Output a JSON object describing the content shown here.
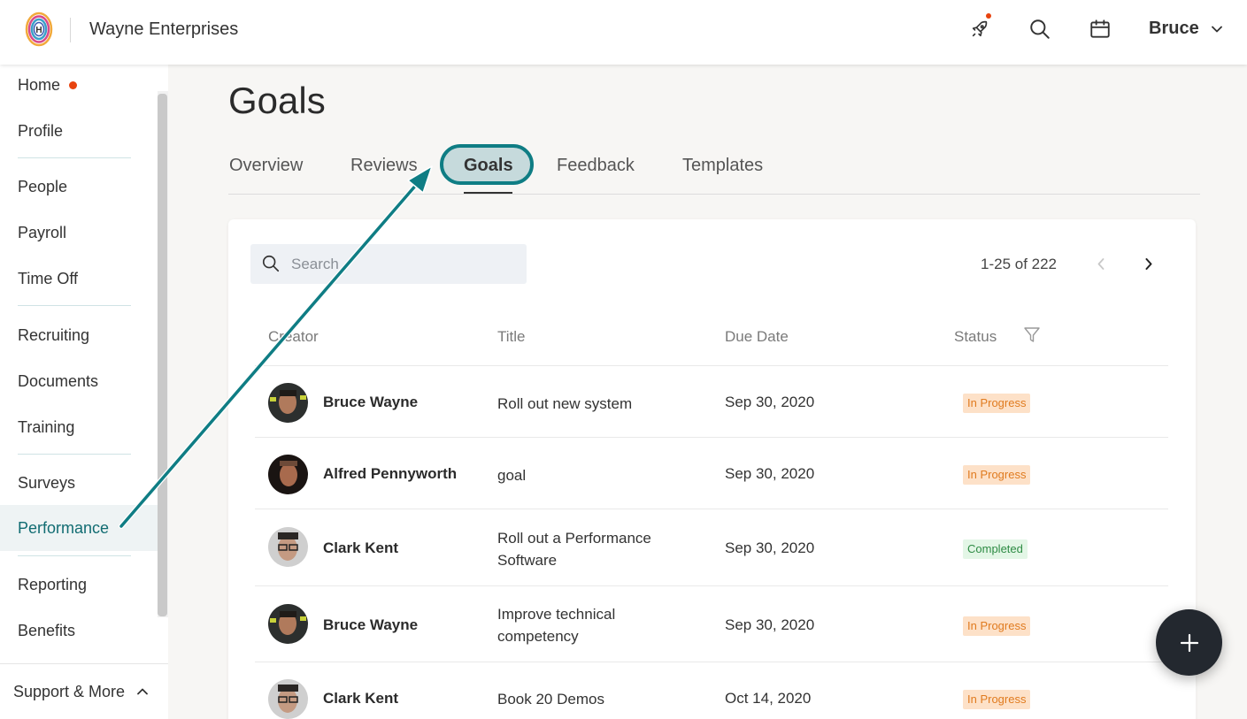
{
  "header": {
    "company": "Wayne Enterprises",
    "logo_letter": "H",
    "user_name": "Bruce"
  },
  "sidebar": {
    "items": [
      {
        "label": "Home"
      },
      {
        "label": "Profile"
      },
      {
        "label": "People"
      },
      {
        "label": "Payroll"
      },
      {
        "label": "Time Off"
      },
      {
        "label": "Recruiting"
      },
      {
        "label": "Documents"
      },
      {
        "label": "Training"
      },
      {
        "label": "Surveys"
      },
      {
        "label": "Performance"
      },
      {
        "label": "Reporting"
      },
      {
        "label": "Benefits"
      }
    ],
    "support_label": "Support & More"
  },
  "page": {
    "title": "Goals",
    "tabs": [
      {
        "label": "Overview"
      },
      {
        "label": "Reviews"
      },
      {
        "label": "Goals"
      },
      {
        "label": "Feedback"
      },
      {
        "label": "Templates"
      }
    ]
  },
  "search": {
    "placeholder": "Search"
  },
  "pagination": {
    "range_text": "1-25 of 222"
  },
  "table": {
    "columns": [
      "Creator",
      "Title",
      "Due Date",
      "Status"
    ],
    "rows": [
      {
        "creator": "Bruce Wayne",
        "title": "Roll out new system",
        "due": "Sep 30, 2020",
        "status": "In Progress"
      },
      {
        "creator": "Alfred Pennyworth",
        "title": "goal",
        "due": "Sep 30, 2020",
        "status": "In Progress"
      },
      {
        "creator": "Clark Kent",
        "title": "Roll out a Performance Software",
        "due": "Sep 30, 2020",
        "status": "Completed"
      },
      {
        "creator": "Bruce Wayne",
        "title": "Improve technical competency",
        "due": "Sep 30, 2020",
        "status": "In Progress"
      },
      {
        "creator": "Clark Kent",
        "title": "Book 20 Demos",
        "due": "Oct 14, 2020",
        "status": "In Progress"
      }
    ]
  },
  "colors": {
    "accent": "#0f7d84",
    "in_progress_bg": "#fde1c8",
    "in_progress_text": "#e07b1f",
    "completed_bg": "#e3f6e6",
    "completed_text": "#2e8b44",
    "notification": "#e8430e"
  }
}
